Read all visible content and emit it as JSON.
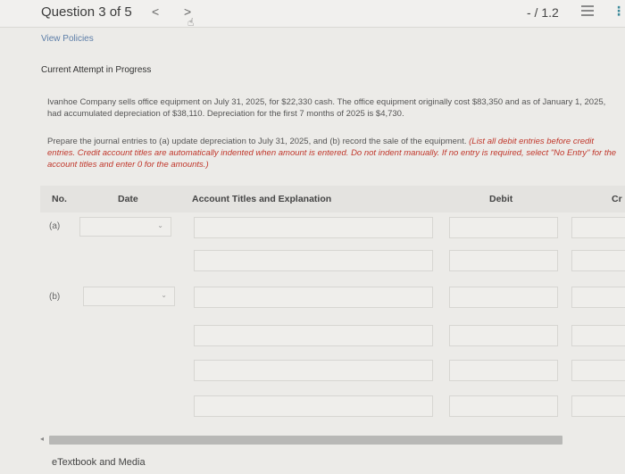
{
  "header": {
    "question_label": "Question 3 of 5",
    "prev_glyph": "<",
    "next_glyph": ">",
    "score": "- / 1.2",
    "more_glyph": "⋮"
  },
  "policies_link": "View Policies",
  "attempt_label": "Current Attempt in Progress",
  "problem_text": "Ivanhoe Company sells office equipment on July 31, 2025, for $22,330 cash. The office equipment originally cost $83,350 and as of January 1, 2025, had accumulated depreciation of $38,110. Depreciation for the first 7 months of 2025 is $4,730.",
  "instructions": {
    "plain": "Prepare the journal entries to (a) update depreciation to July 31, 2025, and (b) record the sale of the equipment. ",
    "emphasis": "(List all debit entries before credit entries. Credit account titles are automatically indented when amount is entered. Do not indent manually. If no entry is required, select \"No Entry\" for the account titles and enter 0 for the amounts.)"
  },
  "table": {
    "headers": {
      "no": "No.",
      "date": "Date",
      "account": "Account Titles and Explanation",
      "debit": "Debit",
      "credit": "Cr"
    },
    "rows": [
      {
        "label": "(a)"
      },
      {
        "label": "(b)"
      }
    ],
    "date_chevron": "⌄"
  },
  "footer": {
    "etextbook": "eTextbook and Media"
  }
}
